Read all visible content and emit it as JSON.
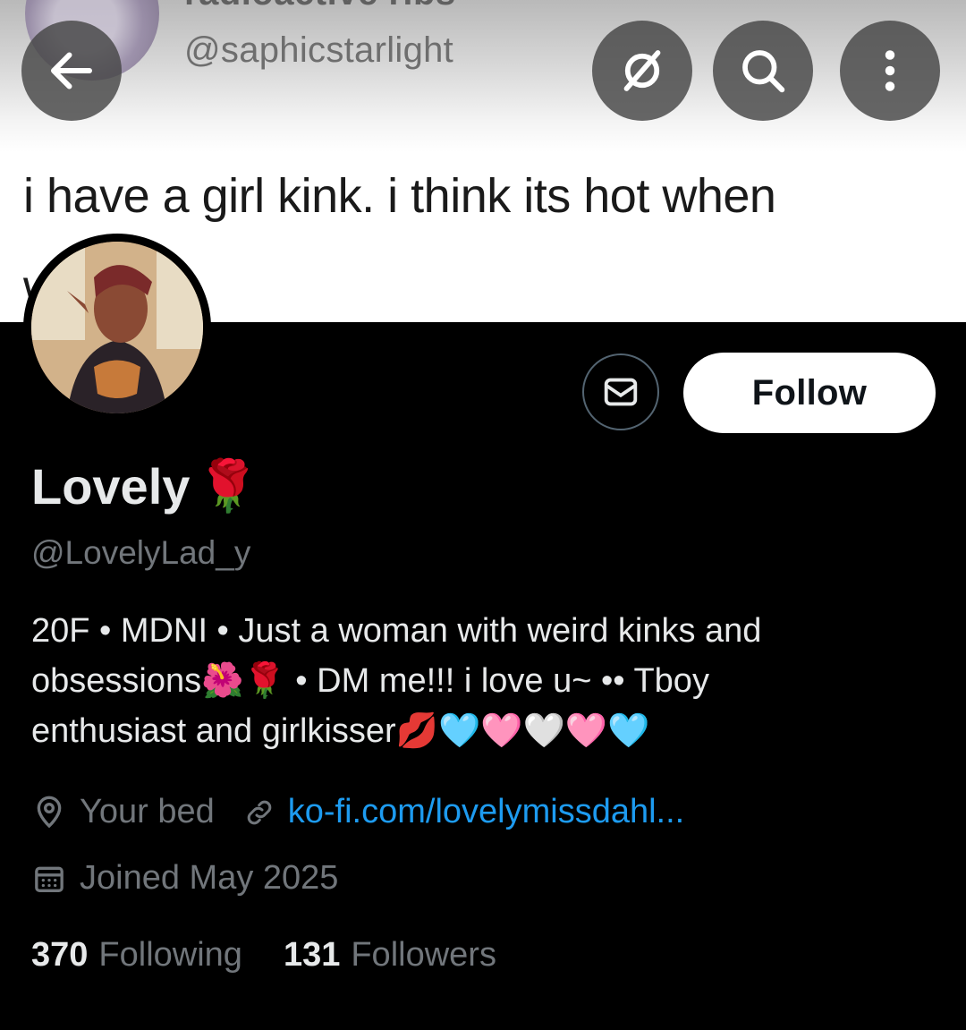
{
  "banner": {
    "quoted_name": "radioactive ribs",
    "quoted_handle": "@saphicstarlight",
    "quoted_text": "i have a girl kink. i think its hot when",
    "quoted_text2": "w"
  },
  "top_bar": {
    "back_icon": "arrow-left-icon",
    "grok_icon": "grok-icon",
    "search_icon": "search-icon",
    "more_icon": "more-vertical-icon"
  },
  "profile": {
    "display_name": "Lovely",
    "name_emoji": "🌹",
    "handle": "@LovelyLad_y",
    "bio_line1": "20F • MDNI • Just a woman with weird kinks and",
    "bio_line2": "obsessions🌺🌹 • DM me!!! i love u~ •• Tboy",
    "bio_line3": "enthusiast and girlkisser💋🩵🩷🤍🩷🩵",
    "location": "Your bed",
    "website": "ko-fi.com/lovelymissdahl...",
    "joined": "Joined May 2025",
    "following_count": "370",
    "following_label": "Following",
    "followers_count": "131",
    "followers_label": "Followers"
  },
  "actions": {
    "follow_label": "Follow",
    "message_icon": "mail-icon"
  },
  "colors": {
    "background": "#000000",
    "link": "#1d9bf0",
    "muted": "#71767b",
    "text": "#e7e9ea"
  }
}
